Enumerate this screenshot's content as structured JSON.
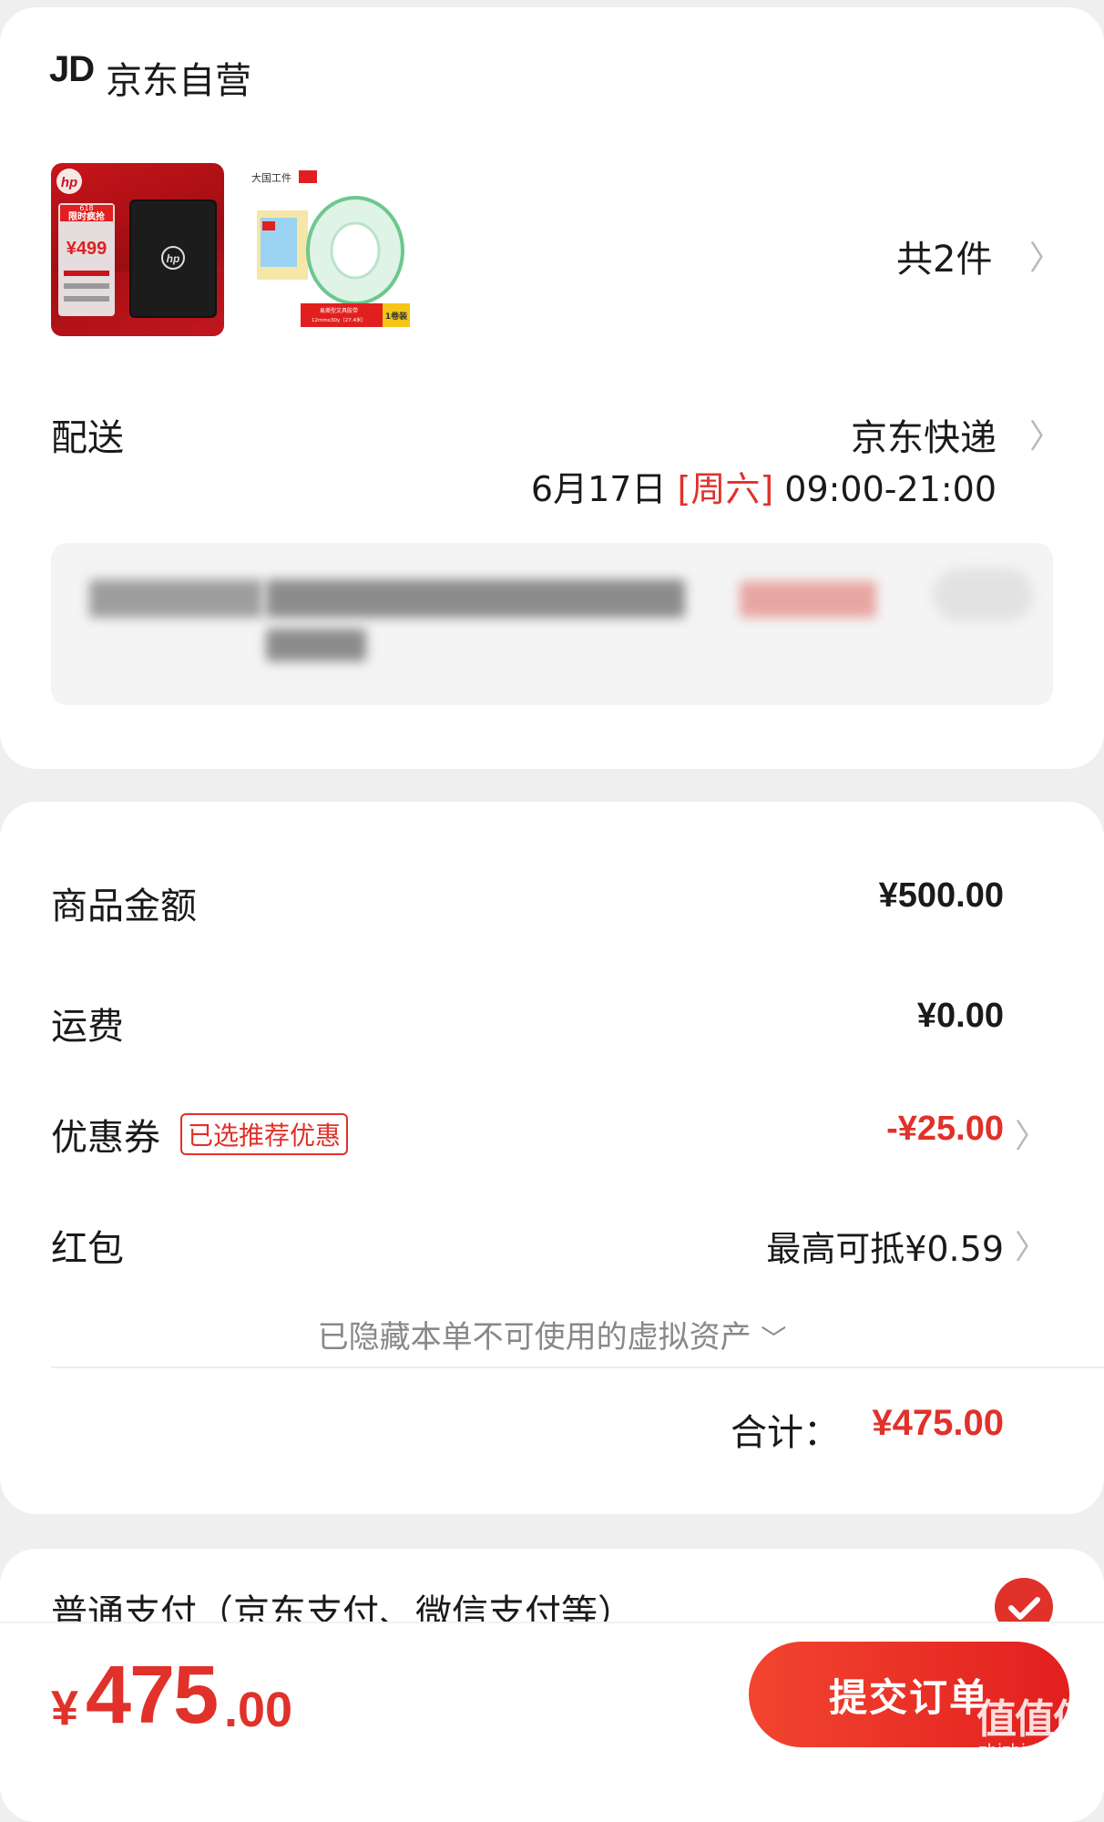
{
  "shop": {
    "logo": "JD",
    "name": "京东自营",
    "ssd_image": {
      "brand": "hp",
      "promo_618": "618",
      "promo_tag": "限时疯抢",
      "price": "¥499"
    },
    "tape_image": {
      "brand_text": "大国工件",
      "pack_label": "1卷装",
      "caption": "易撕型文具胶带",
      "spec": "12mmx30y（27.4米）"
    },
    "item_count": "共2件"
  },
  "delivery": {
    "label": "配送",
    "method": "京东快递",
    "date": "6月17日",
    "weekday": "[周六]",
    "time_range": "09:00-21:00"
  },
  "summary": {
    "goods_label": "商品金额",
    "goods_value": "¥500.00",
    "shipping_label": "运费",
    "shipping_value": "¥0.00",
    "coupon_label": "优惠券",
    "coupon_tag": "已选推荐优惠",
    "coupon_value": "-¥25.00",
    "redpacket_label": "红包",
    "redpacket_value": "最高可抵¥0.59",
    "hidden_assets": "已隐藏本单不可使用的虚拟资产",
    "total_label": "合计：",
    "total_value": "¥475.00"
  },
  "payment": {
    "label": "普通支付（京东支付、微信支付等）"
  },
  "bottom": {
    "currency": "¥",
    "price_int": "475",
    "price_dec": ".00",
    "submit_label": "提交订单",
    "watermark_main": "值值值",
    "watermark_sub": "zhizhizhi.com"
  },
  "colors": {
    "accent": "#e0312a",
    "background": "#efefef",
    "card": "#ffffff"
  }
}
